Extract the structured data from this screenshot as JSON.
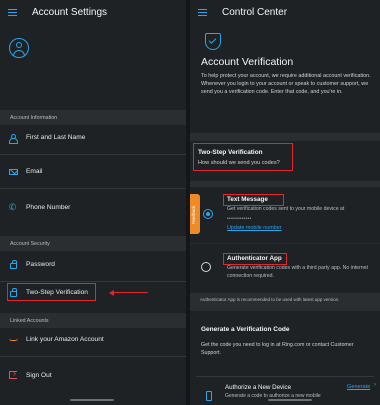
{
  "left": {
    "title": "Account Settings",
    "sections": {
      "account_information": "Account Information",
      "account_security": "Account Security",
      "linked_accounts": "Linked Accounts"
    },
    "rows": {
      "name": "First and Last Name",
      "email": "Email",
      "phone": "Phone Number",
      "password": "Password",
      "two_step": "Two-Step Verification",
      "amazon": "Link your Amazon Account",
      "sign_out": "Sign Out"
    }
  },
  "right": {
    "title": "Control Center",
    "heading": "Account Verification",
    "description": "To help protect your account, we require additional account verification. Whenever you login to your account or speak to customer support, we send you a verification code. Enter that code, and you're in.",
    "two_step_title": "Two-Step Verification",
    "two_step_question": "How should we send you codes?",
    "feedback": "Feedback",
    "text_message": {
      "title": "Text Message",
      "description": "Get verification codes sent to your mobile device at",
      "masked_number": "••••••••••••",
      "update_link": "Update mobile number",
      "selected": true
    },
    "authenticator": {
      "title": "Authenticator App",
      "description": "Generate verification codes with a third party app. No internet connection required.",
      "selected": false
    },
    "recommendation": "Authenticator App is recommended to be used with latest app version.",
    "generate_title": "Generate a Verification Code",
    "generate_description": "Get the code you need to log in at Ring.com or contact Customer Support.",
    "authorize_title": "Authorize a New Device",
    "authorize_description": "Generate a code to authorize a new mobile",
    "generate_link": "Generate"
  },
  "colors": {
    "accent": "#2aa4ea",
    "highlight": "#e3262c",
    "feedback": "#f08a24",
    "signout": "#e0525a"
  }
}
